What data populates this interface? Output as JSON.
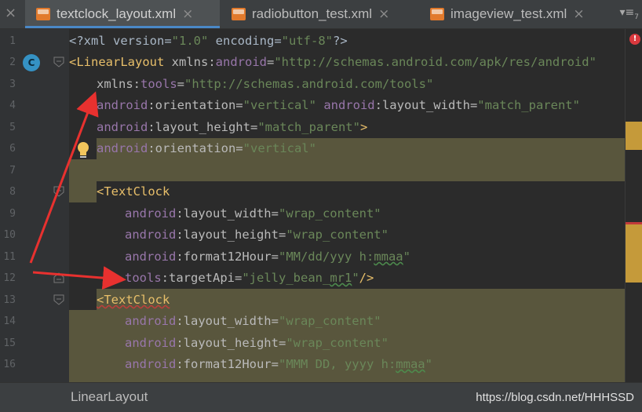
{
  "tabs": [
    {
      "label": "textclock_layout.xml",
      "active": true
    },
    {
      "label": "radiobutton_test.xml",
      "active": false
    },
    {
      "label": "imageview_test.xml",
      "active": false
    }
  ],
  "tab_close_glyph": "×",
  "overflow_label": "≡",
  "overflow_count": "7",
  "gutter": {
    "class_badge": "C"
  },
  "lines": [
    {
      "n": "1"
    },
    {
      "n": "2"
    },
    {
      "n": "3"
    },
    {
      "n": "4"
    },
    {
      "n": "5"
    },
    {
      "n": "6"
    },
    {
      "n": "7"
    },
    {
      "n": "8"
    },
    {
      "n": "9"
    },
    {
      "n": "10"
    },
    {
      "n": "11"
    },
    {
      "n": "12"
    },
    {
      "n": "13"
    },
    {
      "n": "14"
    },
    {
      "n": "15"
    },
    {
      "n": "16"
    }
  ],
  "code": {
    "l1_a": "<?xml version=",
    "l1_b": "\"1.0\"",
    "l1_c": " encoding=",
    "l1_d": "\"utf-8\"",
    "l1_e": "?>",
    "l2_tag": "<LinearLayout",
    "l2_attr": " xmlns:",
    "l2_ns": "android",
    "l2_eq": "=",
    "l2_val": "\"http://schemas.android.com/apk/res/android\"",
    "l3_attr": "xmlns:",
    "l3_ns": "tools",
    "l3_eq": "=",
    "l3_val": "\"http://schemas.android.com/tools\"",
    "l4_ns1": "android",
    "l4_a1": ":orientation=",
    "l4_v1": "\"vertical\"",
    "l4_ns2": " android",
    "l4_a2": ":layout_width=",
    "l4_v2": "\"match_parent\"",
    "l5_ns": "android",
    "l5_a": ":layout_height=",
    "l5_v": "\"match_parent\"",
    "l5_close": ">",
    "l6_ns": "android",
    "l6_a": ":orientation=",
    "l6_v": "\"vertical\"",
    "l8_tag": "<TextClock",
    "l9_ns": "android",
    "l9_a": ":layout_width=",
    "l9_v": "\"wrap_content\"",
    "l10_ns": "android",
    "l10_a": ":layout_height=",
    "l10_v": "\"wrap_content\"",
    "l11_ns": "android",
    "l11_a": ":format12Hour=",
    "l11_v1": "\"MM/dd/yyy h:",
    "l11_v2": "mmaa",
    "l11_v3": "\"",
    "l12_ns": "tools",
    "l12_a": ":targetApi=",
    "l12_v1": "\"jelly_bean_",
    "l12_v2": "mr1",
    "l12_v3": "\"",
    "l12_close": "/>",
    "l13_tag": "<TextClock",
    "l14_ns": "android",
    "l14_a": ":layout_width=",
    "l14_v": "\"wrap_content\"",
    "l15_ns": "android",
    "l15_a": ":layout_height=",
    "l15_v": "\"wrap_content\"",
    "l16_ns": "android",
    "l16_a": ":format12Hour=",
    "l16_v1": "\"MMM DD, yyyy h:",
    "l16_v2": "mmaa",
    "l16_v3": "\""
  },
  "status": {
    "breadcrumb": "LinearLayout",
    "watermark": "https://blog.csdn.net/HHHSSD"
  },
  "error_glyph": "!",
  "colors": {
    "tag": "#e8bf6a",
    "namespace": "#9876aa",
    "value": "#6a8759",
    "highlight": "#59563d",
    "arrow": "#e8312f",
    "accent": "#4a88c7"
  }
}
